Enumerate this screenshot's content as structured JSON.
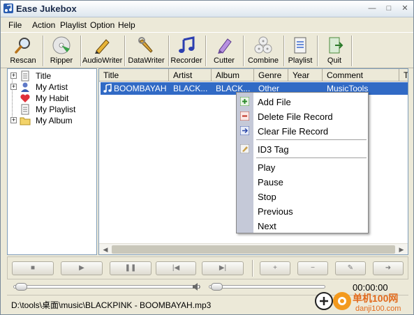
{
  "window": {
    "title": "Ease Jukebox",
    "controls": [
      "—",
      "□",
      "✕"
    ]
  },
  "menu": [
    "File",
    "Action",
    "Playlist",
    "Option",
    "Help"
  ],
  "toolbar": [
    {
      "label": "Rescan",
      "icon": "magnifier-icon"
    },
    {
      "label": "Ripper",
      "icon": "cd-ripper-icon"
    },
    {
      "label": "AudioWriter",
      "icon": "pencil-icon"
    },
    {
      "label": "DataWriter",
      "icon": "wrench-icon"
    },
    {
      "label": "Recorder",
      "icon": "music-note-icon"
    },
    {
      "label": "Cutter",
      "icon": "marker-icon"
    },
    {
      "label": "Combine",
      "icon": "discs-icon"
    },
    {
      "label": "Playlist",
      "icon": "playlist-icon"
    },
    {
      "label": "Quit",
      "icon": "quit-icon"
    }
  ],
  "tree": [
    {
      "label": "Title",
      "icon": "document-icon",
      "expandable": true
    },
    {
      "label": "My Artist",
      "icon": "person-icon",
      "expandable": true
    },
    {
      "label": "My Habit",
      "icon": "heart-icon",
      "expandable": false
    },
    {
      "label": "My Playlist",
      "icon": "document-icon",
      "expandable": false
    },
    {
      "label": "My Album",
      "icon": "folder-icon",
      "expandable": true
    }
  ],
  "list": {
    "columns": [
      "Title",
      "Artist",
      "Album",
      "Genre",
      "Year",
      "Comment",
      "T"
    ],
    "rows": [
      {
        "title": "BOOMBAYAH",
        "artist": "BLACK...",
        "album": "BLACK...",
        "genre": "Other",
        "year": "",
        "comment": "MusicTools"
      }
    ]
  },
  "context_menu": {
    "groups": [
      [
        {
          "label": "Add File",
          "icon": "add-file-icon"
        },
        {
          "label": "Delete File Record",
          "icon": "delete-record-icon"
        },
        {
          "label": "Clear File Record",
          "icon": "clear-record-icon"
        }
      ],
      [
        {
          "label": "ID3 Tag",
          "icon": "id3-tag-icon"
        }
      ],
      [
        {
          "label": "Play"
        },
        {
          "label": "Pause"
        },
        {
          "label": "Stop"
        },
        {
          "label": "Previous"
        },
        {
          "label": "Next"
        }
      ]
    ]
  },
  "player": {
    "buttons": [
      {
        "name": "stop-button",
        "glyph": "■"
      },
      {
        "name": "play-button",
        "glyph": "▶"
      },
      {
        "name": "pause-button",
        "glyph": "❚❚"
      },
      {
        "name": "previous-button",
        "glyph": "|◀"
      },
      {
        "name": "next-button",
        "glyph": "▶|"
      },
      {
        "name": "add-button",
        "glyph": "+"
      },
      {
        "name": "remove-button",
        "glyph": "−"
      },
      {
        "name": "edit-button",
        "glyph": "✎"
      },
      {
        "name": "forward-button",
        "glyph": "➜"
      }
    ],
    "time": "00:00:00",
    "seek_progress": 0,
    "volume_level": 0
  },
  "status": {
    "path": "D:\\tools\\桌面\\music\\BLACKPINK - BOOMBAYAH.mp3"
  },
  "watermark": {
    "line1": "单机100网",
    "line2": "danji100.com"
  }
}
